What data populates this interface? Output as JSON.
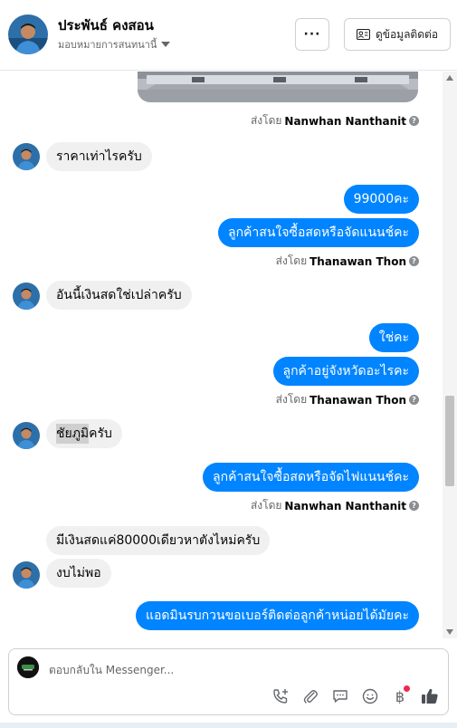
{
  "header": {
    "name": "ประพันธ์ คงสอน",
    "assigned": "มอบหมายการสนทนานี้",
    "more_label": "···",
    "contact_button": "ดูข้อมูลติดต่อ"
  },
  "messages": [
    {
      "kind": "sent_by",
      "prefix": "ส่งโดย",
      "name": "Nanwhan Nanthanit"
    },
    {
      "kind": "in",
      "text": "ราคาเท่าไรครับ"
    },
    {
      "kind": "out",
      "text": "99000คะ"
    },
    {
      "kind": "out",
      "text": "ลูกค้าสนใจซื้อสดหรือจัดแนนช์คะ"
    },
    {
      "kind": "sent_by",
      "prefix": "ส่งโดย",
      "name": "Thanawan Thon"
    },
    {
      "kind": "in",
      "text": "อันนี้เงินสดใช่เปล่าครับ"
    },
    {
      "kind": "out",
      "text": "ใช่คะ"
    },
    {
      "kind": "out",
      "text": "ลูกค้าอยู่จังหวัดอะไรคะ"
    },
    {
      "kind": "sent_by",
      "prefix": "ส่งโดย",
      "name": "Thanawan Thon"
    },
    {
      "kind": "in",
      "text_highlight": "ชัยภูมิ",
      "text_rest": "ครับ"
    },
    {
      "kind": "out",
      "text": "ลูกค้าสนใจซื้อสดหรือจัดไฟแนนช์คะ"
    },
    {
      "kind": "sent_by",
      "prefix": "ส่งโดย",
      "name": "Nanwhan Nanthanit"
    },
    {
      "kind": "in",
      "text": "มีเงินสดแค่80000เดียวหาตังไหม่ครับ"
    },
    {
      "kind": "in",
      "text": "งบไม่พอ"
    },
    {
      "kind": "out",
      "text": "แอดมินรบกวนขอเบอร์ติดต่อลูกค้าหน่อยได้มัยคะ"
    }
  ],
  "composer": {
    "placeholder": "ตอบกลับใน Messenger..."
  },
  "icons": {
    "call": "phone-plus-icon",
    "attach": "paperclip-icon",
    "saved_replies": "chat-bubble-icon",
    "emoji": "smiley-icon",
    "payment": "baht-icon",
    "like": "thumbs-up-icon"
  },
  "payment_symbol": "฿",
  "colors": {
    "accent": "#0084ff",
    "incoming_bubble": "#f0f0f0",
    "notification": "#f02849"
  }
}
